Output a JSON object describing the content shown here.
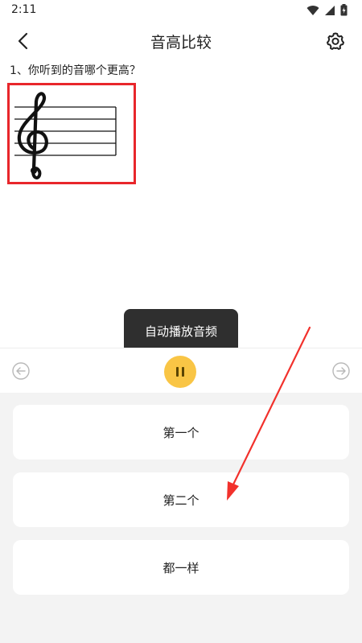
{
  "status_bar": {
    "time": "2:11"
  },
  "header": {
    "title": "音高比较"
  },
  "question": {
    "text": "1、你听到的音哪个更高？"
  },
  "toast": {
    "text": "自动播放音频"
  },
  "options": [
    {
      "label": "第一个"
    },
    {
      "label": "第二个"
    },
    {
      "label": "都一样"
    }
  ],
  "colors": {
    "accent": "#f9c545",
    "highlight_border": "#e8262b",
    "annotation_arrow": "#f2312c",
    "options_background": "#f3f3f3",
    "toast_background": "#2f2f2f"
  },
  "icons": {
    "back": "chevron-left-icon",
    "settings": "gear-icon",
    "prev": "arrow-left-circle-icon",
    "next": "arrow-right-circle-icon",
    "play_state": "pause-icon"
  }
}
